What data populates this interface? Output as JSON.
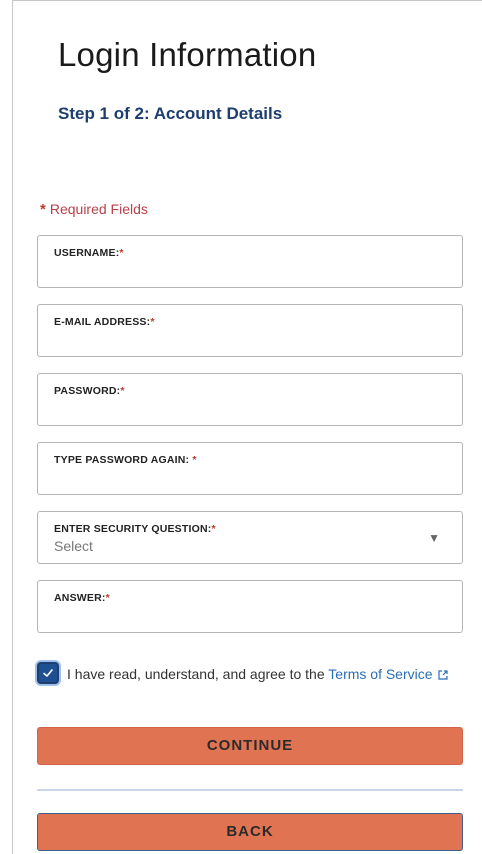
{
  "header": {
    "title": "Login Information",
    "step": "Step 1 of 2: Account Details"
  },
  "required_note": {
    "star": "*",
    "text": "Required Fields"
  },
  "fields": [
    {
      "label": "USERNAME:",
      "required_mark": "*",
      "value": ""
    },
    {
      "label": "E-MAIL ADDRESS:",
      "required_mark": "*",
      "value": ""
    },
    {
      "label": "PASSWORD:",
      "required_mark": "*",
      "value": ""
    },
    {
      "label": "TYPE PASSWORD AGAIN: ",
      "required_mark": "*",
      "value": ""
    },
    {
      "label": "ENTER SECURITY QUESTION:",
      "required_mark": "*",
      "value": "Select",
      "caret": "▼"
    },
    {
      "label": "ANSWER:",
      "required_mark": "*",
      "value": ""
    }
  ],
  "agreement": {
    "checked": true,
    "text": "I have read, understand, and agree to the ",
    "link_text": "Terms of Service"
  },
  "buttons": {
    "continue": "CONTINUE",
    "back": "BACK"
  },
  "colors": {
    "title_blue": "#1d3e6e",
    "required_red": "#c0392b",
    "button_orange": "#e07352",
    "link_blue": "#2a6db5"
  },
  "icons": {
    "checkbox": "check-icon",
    "external_link": "external-link-icon",
    "dropdown": "chevron-down-icon"
  }
}
